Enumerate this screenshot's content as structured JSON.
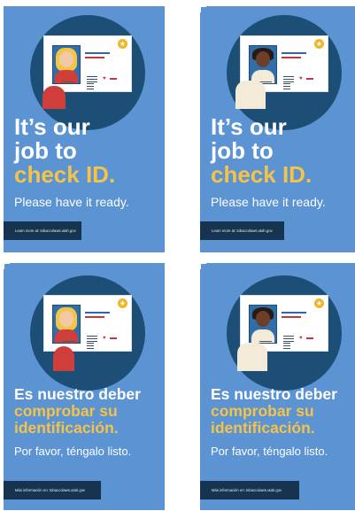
{
  "cards": [
    {
      "headline_line1": "It’s our",
      "headline_line2": "job to",
      "headline_highlight": "check ID.",
      "subtitle": "Please have it ready.",
      "footer": "Learn more at: tobaccolaws.utah.gov",
      "person": "woman",
      "language": "english"
    },
    {
      "headline_line1": "It’s our",
      "headline_line2": "job to",
      "headline_highlight": "check ID.",
      "subtitle": "Please have it ready.",
      "footer": "Learn more at: tobaccolaws.utah.gov",
      "person": "man",
      "language": "english"
    },
    {
      "headline_line1": "Es nuestro deber",
      "headline_line2": "comprobar su",
      "headline_highlight": "identificación.",
      "subtitle": "Por favor, téngalo listo.",
      "footer": "Más información en: tobaccolaws.utah.gov",
      "person": "woman",
      "language": "spanish"
    },
    {
      "headline_line1": "Es nuestro deber",
      "headline_line2": "comprobar su",
      "headline_highlight": "identificación.",
      "subtitle": "Por favor, téngalo listo.",
      "footer": "Más información en: tobaccolaws.utah.gov",
      "person": "man",
      "language": "spanish"
    }
  ],
  "colors": {
    "background_blue": "#5b93d3",
    "disc_navy": "#1d4f76",
    "highlight_yellow": "#f5c347",
    "footer_navy": "#16344f",
    "star_gold": "#f0b62a",
    "accent_red": "#c9343d"
  },
  "icons": [
    "star-icon",
    "heart-icon"
  ]
}
